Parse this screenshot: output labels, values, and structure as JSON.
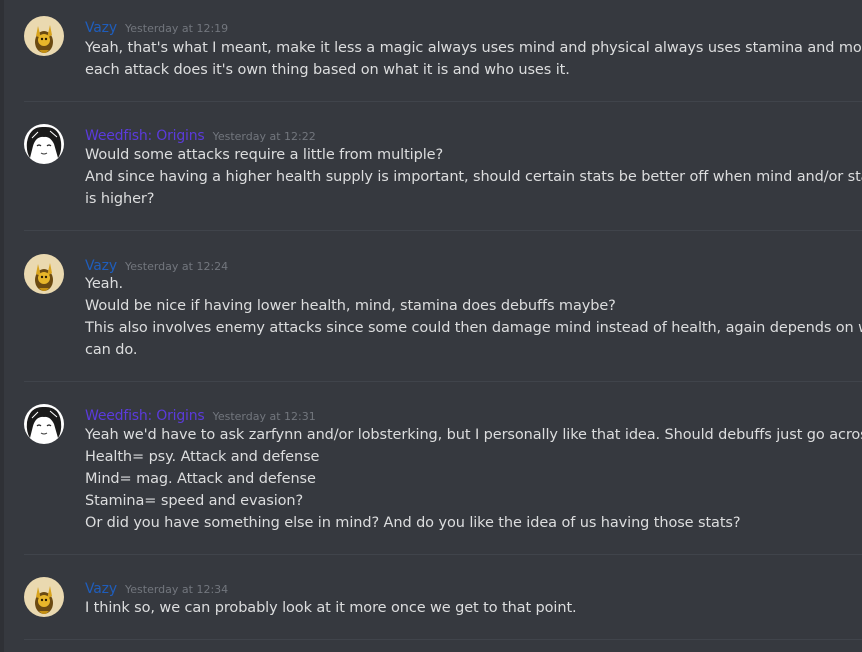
{
  "colors": {
    "background": "#36393f",
    "vazy_name": "#1f5dbb",
    "weedfish_name": "#5b3bdb",
    "message_text": "#dcddde",
    "timestamp": "#72767d",
    "divider": "#40444b"
  },
  "messages": [
    {
      "author": "Vazy",
      "timestamp": "Yesterday at 12:19",
      "avatar": "vazy-avatar-icon",
      "lines": [
        "Yeah, that's what I meant, make it less a magic always uses mind and physical always uses stamina and more a",
        "each attack does it's own thing based on what it is and who uses it."
      ]
    },
    {
      "author": "Weedfish: Origins",
      "timestamp": "Yesterday at 12:22",
      "avatar": "weedfish-avatar-icon",
      "lines": [
        "Would some attacks require a little from multiple?",
        "And since having a higher health supply is important, should certain stats be better off when mind and/or stamina",
        "is higher?"
      ]
    },
    {
      "author": "Vazy",
      "timestamp": "Yesterday at 12:24",
      "avatar": "vazy-avatar-icon",
      "lines": [
        "Yeah.",
        "Would be nice if having lower health, mind, stamina does debuffs maybe?",
        "This also involves enemy attacks since some could then damage mind instead of health, again depends on what we",
        "can do."
      ]
    },
    {
      "author": "Weedfish: Origins",
      "timestamp": "Yesterday at 12:31",
      "avatar": "weedfish-avatar-icon",
      "lines": [
        "Yeah we'd have to ask zarfynn and/or lobsterking, but I personally like that idea. Should debuffs just go across like",
        "Health= psy. Attack and defense",
        "Mind= mag. Attack and defense",
        "Stamina= speed and evasion?",
        "Or did you have something else in mind? And do you like the idea of us having those stats?"
      ]
    },
    {
      "author": "Vazy",
      "timestamp": "Yesterday at 12:34",
      "avatar": "vazy-avatar-icon",
      "lines": [
        "I think so, we can probably look at it more once we get to that point."
      ]
    }
  ]
}
